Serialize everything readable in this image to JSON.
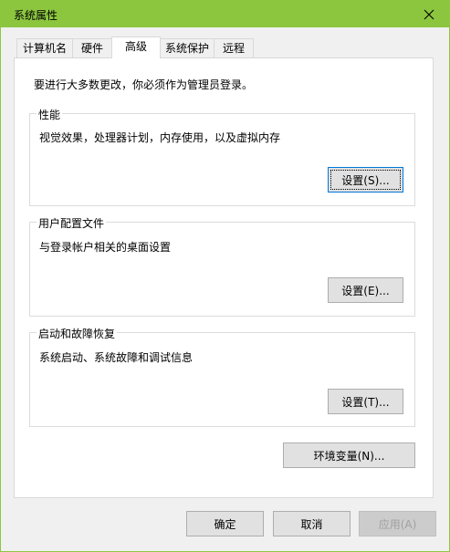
{
  "window": {
    "title": "系统属性"
  },
  "tabs": [
    {
      "label": "计算机名"
    },
    {
      "label": "硬件"
    },
    {
      "label": "高级"
    },
    {
      "label": "系统保护"
    },
    {
      "label": "远程"
    }
  ],
  "advanced": {
    "admin_note": "要进行大多数更改，你必须作为管理员登录。",
    "performance": {
      "title": "性能",
      "desc": "视觉效果，处理器计划，内存使用，以及虚拟内存",
      "button": "设置(S)..."
    },
    "user_profiles": {
      "title": "用户配置文件",
      "desc": "与登录帐户相关的桌面设置",
      "button": "设置(E)..."
    },
    "startup_recovery": {
      "title": "启动和故障恢复",
      "desc": "系统启动、系统故障和调试信息",
      "button": "设置(T)..."
    },
    "env_vars_button": "环境变量(N)..."
  },
  "footer": {
    "ok": "确定",
    "cancel": "取消",
    "apply": "应用(A)"
  }
}
